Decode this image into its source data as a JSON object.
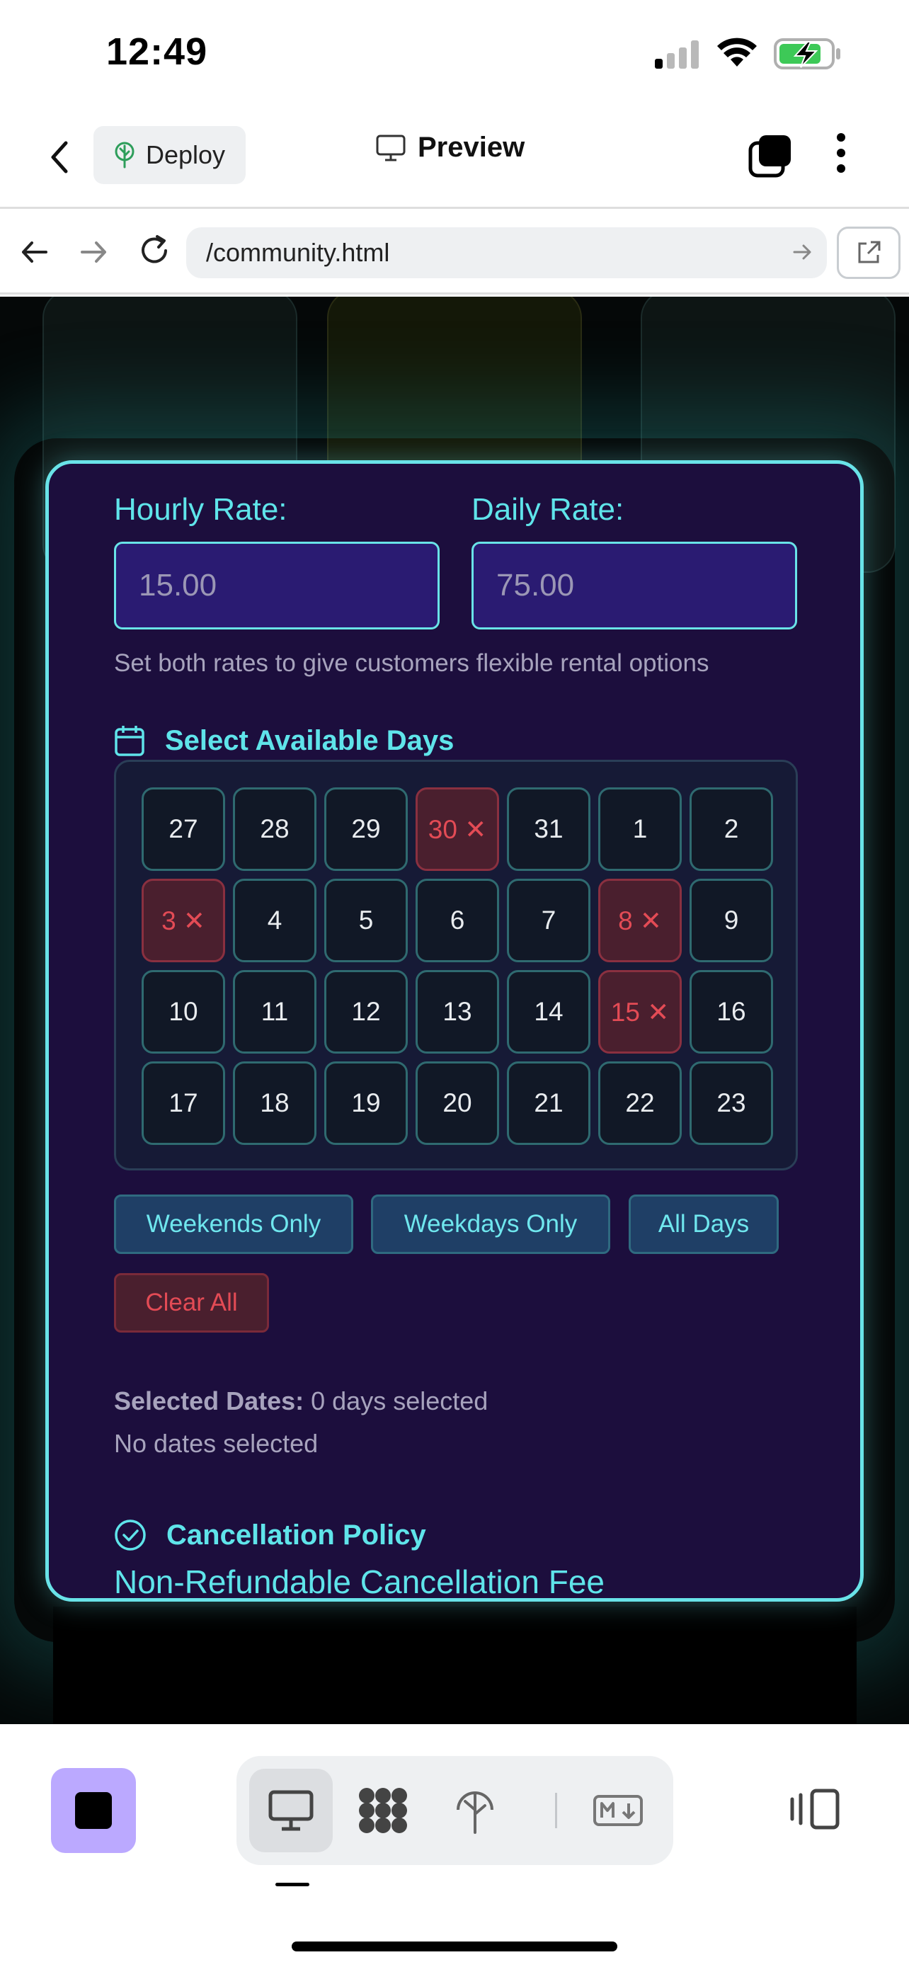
{
  "status": {
    "time": "12:49"
  },
  "header": {
    "deploy_label": "Deploy",
    "title": "Preview"
  },
  "browser": {
    "url": "/community.html"
  },
  "form": {
    "hourly_label": "Hourly Rate:",
    "hourly_value": "15.00",
    "daily_label": "Daily Rate:",
    "daily_value": "75.00",
    "helper": "Set both rates to give customers flexible rental options",
    "days_title": "Select Available Days",
    "calendar": [
      [
        {
          "d": "27",
          "blocked": false
        },
        {
          "d": "28",
          "blocked": false
        },
        {
          "d": "29",
          "blocked": false
        },
        {
          "d": "30 ✕",
          "blocked": true
        },
        {
          "d": "31",
          "blocked": false
        },
        {
          "d": "1",
          "blocked": false
        },
        {
          "d": "2",
          "blocked": false
        }
      ],
      [
        {
          "d": "3 ✕",
          "blocked": true
        },
        {
          "d": "4",
          "blocked": false
        },
        {
          "d": "5",
          "blocked": false
        },
        {
          "d": "6",
          "blocked": false
        },
        {
          "d": "7",
          "blocked": false
        },
        {
          "d": "8 ✕",
          "blocked": true
        },
        {
          "d": "9",
          "blocked": false
        }
      ],
      [
        {
          "d": "10",
          "blocked": false
        },
        {
          "d": "11",
          "blocked": false
        },
        {
          "d": "12",
          "blocked": false
        },
        {
          "d": "13",
          "blocked": false
        },
        {
          "d": "14",
          "blocked": false
        },
        {
          "d": "15 ✕",
          "blocked": true
        },
        {
          "d": "16",
          "blocked": false
        }
      ],
      [
        {
          "d": "17",
          "blocked": false
        },
        {
          "d": "18",
          "blocked": false
        },
        {
          "d": "19",
          "blocked": false
        },
        {
          "d": "20",
          "blocked": false
        },
        {
          "d": "21",
          "blocked": false
        },
        {
          "d": "22",
          "blocked": false
        },
        {
          "d": "23",
          "blocked": false
        }
      ]
    ],
    "quick": {
      "weekends": "Weekends Only",
      "weekdays": "Weekdays Only",
      "all": "All Days",
      "clear": "Clear All"
    },
    "selected_label": "Selected Dates:",
    "selected_value": "0 days selected",
    "no_dates": "No dates selected",
    "cancel_title": "Cancellation Policy",
    "fee_label": "Non-Refundable Cancellation Fee"
  },
  "colors": {
    "accent": "#5fe4ea",
    "panel": "#1c0e3d",
    "blocked": "#e34b55",
    "stop": "#bba9ff"
  }
}
